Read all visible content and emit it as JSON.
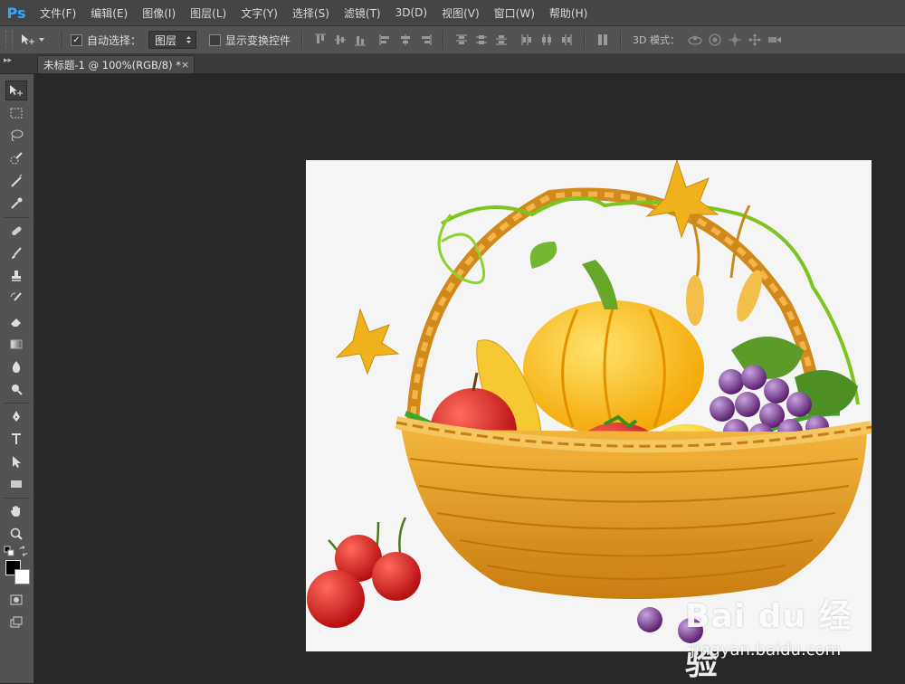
{
  "app": {
    "logo": "Ps"
  },
  "menu": [
    "文件(F)",
    "编辑(E)",
    "图像(I)",
    "图层(L)",
    "文字(Y)",
    "选择(S)",
    "滤镜(T)",
    "3D(D)",
    "视图(V)",
    "窗口(W)",
    "帮助(H)"
  ],
  "options": {
    "auto_select_label": "自动选择：",
    "auto_select_checked": true,
    "auto_select_value": "图层",
    "show_transform_label": "显示变换控件",
    "mode_3d_label": "3D 模式："
  },
  "tab": {
    "title": "未标题-1 @ 100%(RGB/8) *",
    "close": "×"
  },
  "colors": {
    "foreground": "#000000",
    "background": "#ffffff"
  },
  "watermark": {
    "logo": "Bai du 经验",
    "url": "jingyan.baidu.com"
  }
}
